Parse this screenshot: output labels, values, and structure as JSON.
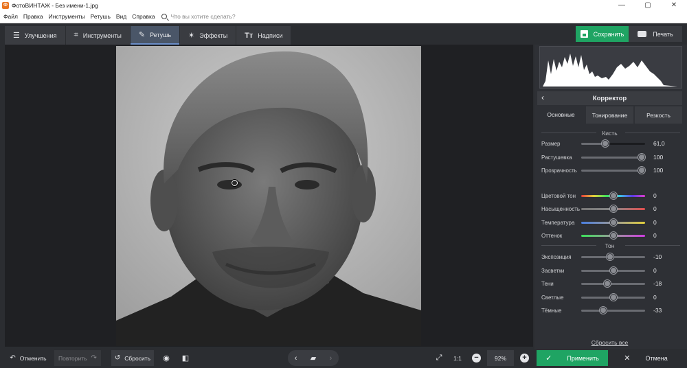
{
  "titlebar": {
    "title": "ФотоВИНТАЖ - Без имени-1.jpg",
    "minimize": "—",
    "maximize": "▢",
    "close": "✕"
  },
  "menu": {
    "items": [
      "Файл",
      "Правка",
      "Инструменты",
      "Ретушь",
      "Вид",
      "Справка"
    ],
    "search_placeholder": "Что вы хотите сделать?"
  },
  "tabs": [
    {
      "label": "Улучшения",
      "icon": "sliders-icon",
      "active": false
    },
    {
      "label": "Инструменты",
      "icon": "crop-icon",
      "active": false
    },
    {
      "label": "Ретушь",
      "icon": "brush-icon",
      "active": true
    },
    {
      "label": "Эффекты",
      "icon": "magic-wand-icon",
      "active": false
    },
    {
      "label": "Надписи",
      "icon": "text-icon",
      "active": false
    }
  ],
  "actions": {
    "save_label": "Сохранить",
    "print_label": "Печать"
  },
  "panel": {
    "title": "Корректор",
    "subtabs": [
      {
        "label": "Основные",
        "active": true
      },
      {
        "label": "Тонирование",
        "active": false
      },
      {
        "label": "Резкость",
        "active": false
      }
    ],
    "section_brush": "Кисть",
    "brush_sliders": [
      {
        "label": "Размер",
        "value": "61,0",
        "pos": 0.38
      },
      {
        "label": "Растушевка",
        "value": "100",
        "pos": 0.95
      },
      {
        "label": "Прозрачность",
        "value": "100",
        "pos": 0.95
      }
    ],
    "color_sliders": [
      {
        "label": "Цветовой тон",
        "value": "0",
        "pos": 0.5
      },
      {
        "label": "Насыщенность",
        "value": "0",
        "pos": 0.5
      },
      {
        "label": "Температура",
        "value": "0",
        "pos": 0.5
      },
      {
        "label": "Оттенок",
        "value": "0",
        "pos": 0.5
      }
    ],
    "section_tone": "Тон",
    "tone_sliders": [
      {
        "label": "Экспозиция",
        "value": "-10",
        "pos": 0.45
      },
      {
        "label": "Засветки",
        "value": "0",
        "pos": 0.5
      },
      {
        "label": "Тени",
        "value": "-18",
        "pos": 0.41
      },
      {
        "label": "Светлые",
        "value": "0",
        "pos": 0.5
      },
      {
        "label": "Тёмные",
        "value": "-33",
        "pos": 0.34
      }
    ],
    "reset_all": "Сбросить все"
  },
  "bottom": {
    "undo_label": "Отменить",
    "redo_label": "Повторить",
    "reset_label": "Сбросить",
    "zoom_11": "1:1",
    "zoom_value": "92%",
    "apply_label": "Применить",
    "cancel_label": "Отмена"
  },
  "colors": {
    "accent_green": "#1fa463",
    "active_tab": "#4a5668",
    "panel_bg": "#2e3035"
  }
}
